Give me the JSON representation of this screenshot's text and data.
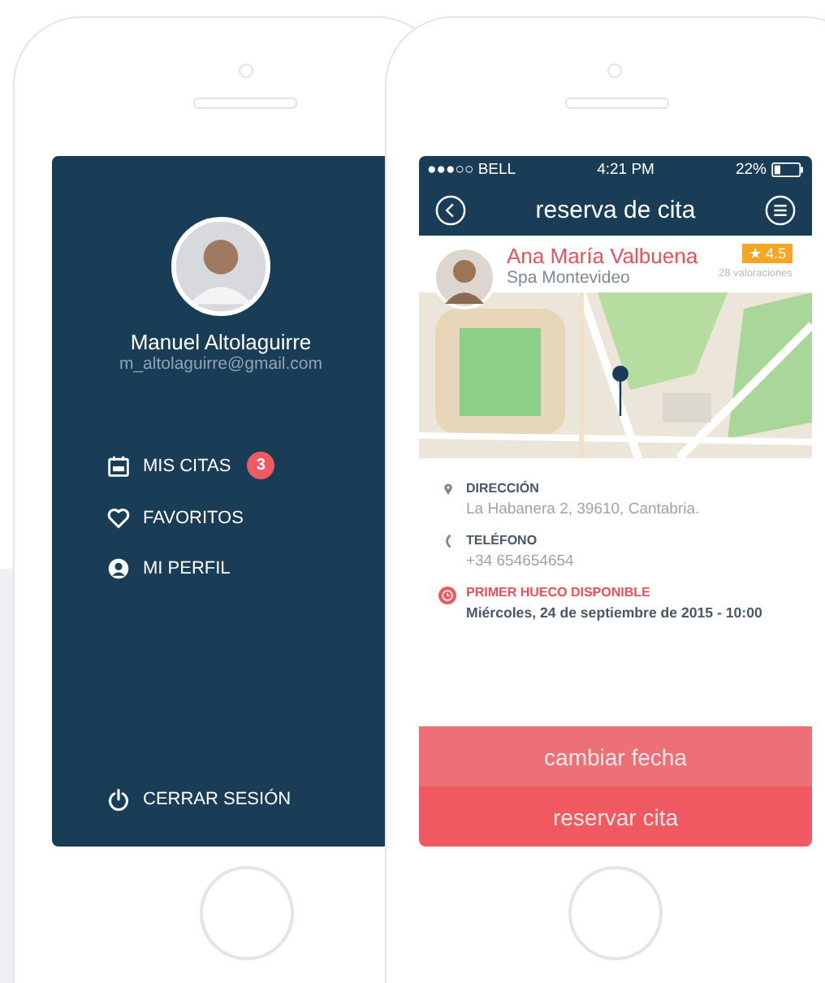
{
  "menu_screen": {
    "user_name": "Manuel Altolaguirre",
    "email": "m_altolaguirre@gmail.com",
    "items": [
      {
        "kind": "appointments",
        "label": "MIS CITAS",
        "badge": "3"
      },
      {
        "kind": "favorites",
        "label": "FAVORITOS"
      },
      {
        "kind": "profile",
        "label": "MI PERFIL"
      }
    ],
    "logout": "CERRAR SESIÓN"
  },
  "booking_screen": {
    "status_bar": {
      "carrier": "●●●○○ BELL",
      "time": "4:21 PM",
      "battery": "22%"
    },
    "title": "reserva de cita",
    "provider": {
      "name": "Ana María Valbuena",
      "place": "Spa Montevideo",
      "rating": "★ 4.5",
      "reviews": "28 valoraciones"
    },
    "details": [
      {
        "kind": "location",
        "label": "DIRECCIÓN",
        "value": "La Habanera 2, 39610, Cantabria."
      },
      {
        "kind": "phone",
        "label": "TELÉFONO",
        "value": "+34 654654654"
      },
      {
        "kind": "slot",
        "label": "PRIMER HUECO DISPONIBLE",
        "value": "Miércoles, 24 de septiembre de 2015 - 10:00"
      }
    ],
    "buttons": [
      {
        "kind": "secondary",
        "label": "cambiar fecha"
      },
      {
        "kind": "primary",
        "label": "reservar cita"
      }
    ]
  }
}
